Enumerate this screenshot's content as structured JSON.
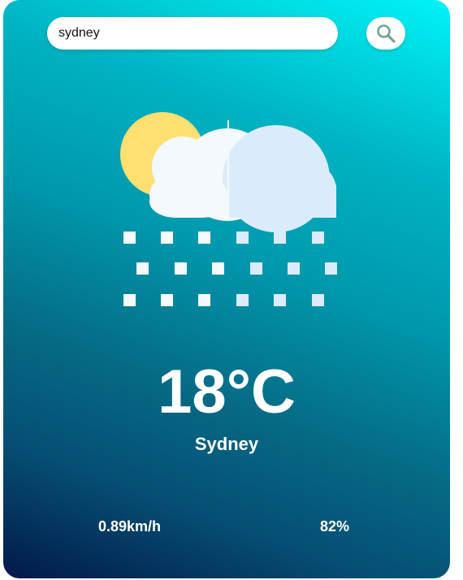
{
  "search": {
    "value": "sydney",
    "placeholder": "",
    "icon": "search-icon"
  },
  "weather": {
    "icon": "snow-cloud-sun-icon",
    "temperature": "18°C",
    "city": "Sydney",
    "wind_speed": "0.89km/h",
    "humidity": "82%"
  },
  "colors": {
    "gradient_top": "#00f3f8",
    "gradient_bottom": "#03194a",
    "sun": "#ffdf70",
    "cloud_light": "#f4f9fd",
    "cloud_shade": "#dcebfb",
    "search_icon": "#6fa68f"
  }
}
